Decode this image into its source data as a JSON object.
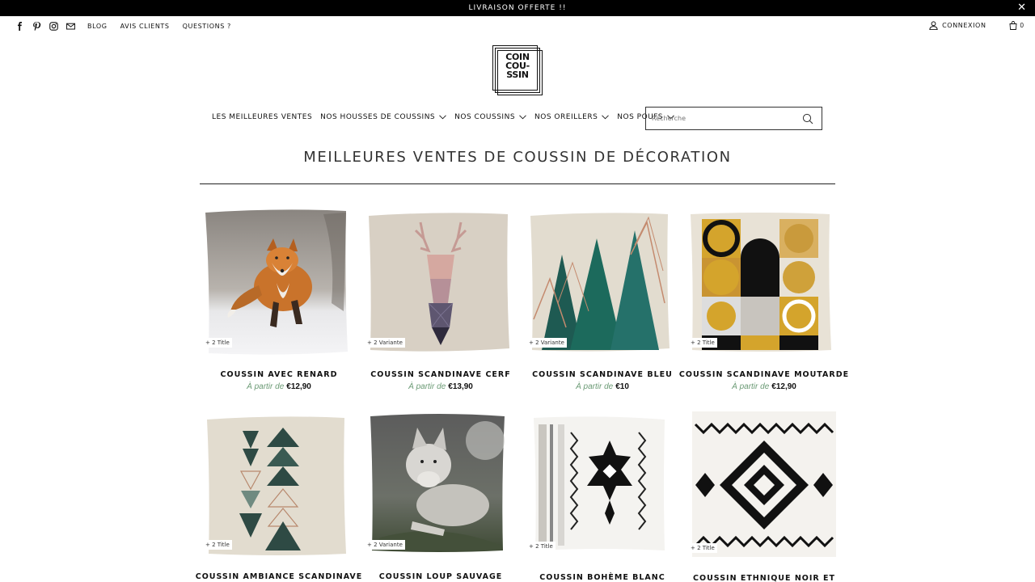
{
  "announcement": {
    "text": "LIVRAISON OFFERTE !!",
    "close": "✕"
  },
  "topbar": {
    "social_icons": [
      "facebook-icon",
      "pinterest-icon",
      "instagram-icon",
      "mail-icon"
    ],
    "links": [
      "BLOG",
      "AVIS CLIENTS",
      "QUESTIONS ?"
    ],
    "login": "CONNEXION",
    "cart_count": "0"
  },
  "logo": {
    "line1": "COIN",
    "line2": "COU-",
    "line3": "SSIN"
  },
  "nav": {
    "items": [
      {
        "label": "LES MEILLEURES VENTES",
        "dropdown": false
      },
      {
        "label": "NOS HOUSSES DE COUSSINS",
        "dropdown": true
      },
      {
        "label": "NOS COUSSINS",
        "dropdown": true
      },
      {
        "label": "NOS OREILLERS",
        "dropdown": true
      },
      {
        "label": "NOS POUFS",
        "dropdown": true
      }
    ]
  },
  "search": {
    "placeholder": "Recherche"
  },
  "page_title": "MEILLEURES VENTES DE COUSSIN DE DÉCORATION",
  "products": [
    {
      "name": "COUSSIN AVEC RENARD",
      "badge": "+ 2 Title",
      "price_prefix": "À partir de",
      "price": "€12,90"
    },
    {
      "name": "COUSSIN SCANDINAVE CERF",
      "badge": "+ 2 Variante",
      "price_prefix": "À partir de",
      "price": "€13,90"
    },
    {
      "name": "COUSSIN SCANDINAVE BLEU",
      "badge": "+ 2 Variante",
      "price_prefix": "À partir de",
      "price": "€10"
    },
    {
      "name": "COUSSIN SCANDINAVE MOUTARDE",
      "badge": "+ 2 Title",
      "price_prefix": "À partir de",
      "price": "€12,90"
    },
    {
      "name": "COUSSIN AMBIANCE SCANDINAVE",
      "badge": "+ 2 Title"
    },
    {
      "name": "COUSSIN LOUP SAUVAGE",
      "badge": "+ 2 Variante"
    },
    {
      "name": "COUSSIN BOHÈME BLANC",
      "badge": "+ 2 Title"
    },
    {
      "name": "COUSSIN ETHNIQUE NOIR ET",
      "badge": "+ 2 Title"
    }
  ],
  "colors": {
    "accent_price": "#6a9a74",
    "announce_bg": "#000000"
  }
}
